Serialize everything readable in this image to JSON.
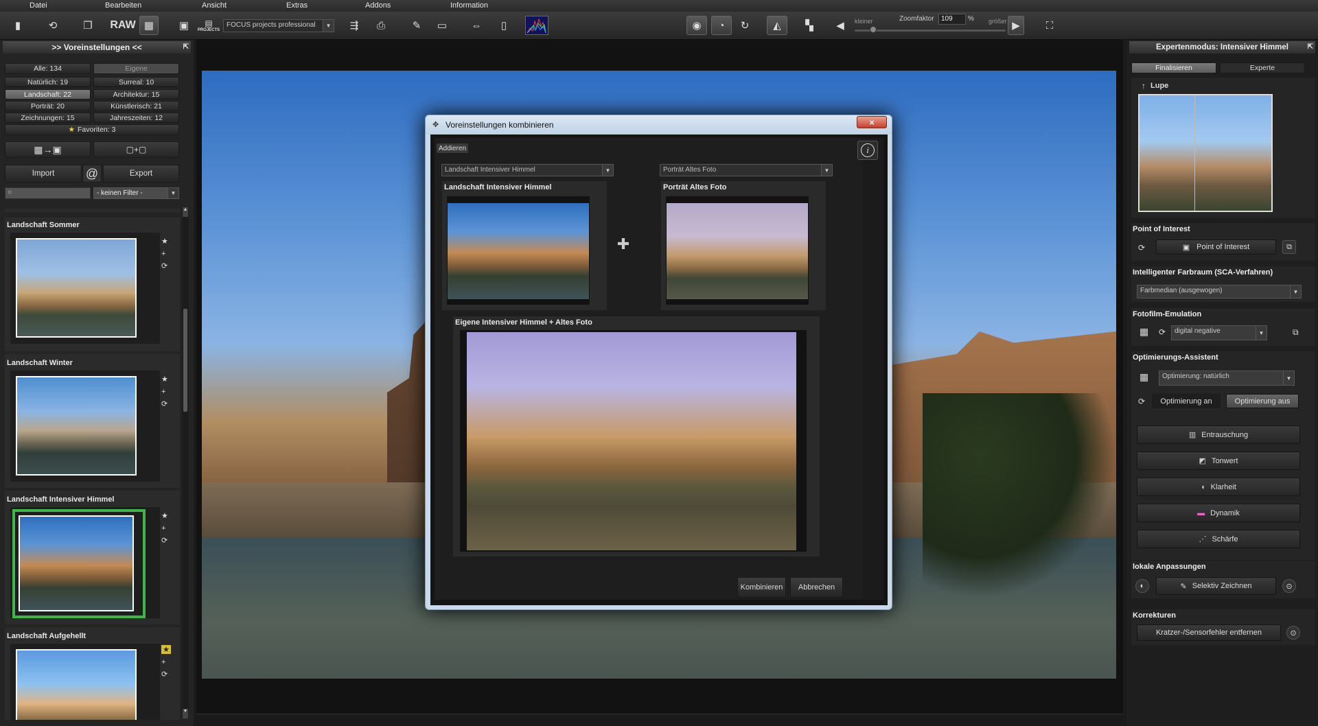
{
  "menu": [
    "Datei",
    "Bearbeiten",
    "Ansicht",
    "Extras",
    "Addons",
    "Information"
  ],
  "toolbar": {
    "raw_label": "RAW",
    "projects_label": "PROJECTS",
    "profile_select": "FOCUS projects professional",
    "zoom_smaller": "kleiner",
    "zoom_label": "Zoomfaktor",
    "zoom_value": "109",
    "zoom_unit": "%",
    "zoom_larger": "größer"
  },
  "left": {
    "title": ">> Voreinstellungen <<",
    "filters": [
      {
        "label": "Alle: 134"
      },
      {
        "label": "Eigene"
      },
      {
        "label": "Natürlich: 19"
      },
      {
        "label": "Surreal: 10"
      },
      {
        "label": "Landschaft: 22"
      },
      {
        "label": "Architektur: 15"
      },
      {
        "label": "Porträt: 20"
      },
      {
        "label": "Künstlerisch: 21"
      },
      {
        "label": "Zeichnungen: 15"
      },
      {
        "label": "Jahreszeiten: 12"
      }
    ],
    "favorites": "Favoriten: 3",
    "import_label": "Import",
    "export_label": "Export",
    "at_label": "@",
    "filter_select": "- keinen Filter -",
    "presets": [
      {
        "name": "Landschaft Sommer"
      },
      {
        "name": "Landschaft Winter"
      },
      {
        "name": "Landschaft Intensiver Himmel"
      },
      {
        "name": "Landschaft Aufgehellt"
      }
    ]
  },
  "dialog": {
    "title": "Voreinstellungen kombinieren",
    "close": "×",
    "add_tab": "Addieren",
    "select_left": "Landschaft Intensiver Himmel",
    "select_right": "Porträt Altes Foto",
    "label_left": "Landschaft Intensiver Himmel",
    "label_right": "Porträt Altes Foto",
    "plus": "✚",
    "result_label": "Eigene Intensiver Himmel + Altes Foto",
    "combine_button": "Kombinieren",
    "cancel_button": "Abbrechen",
    "info": "i"
  },
  "right": {
    "title": "Expertenmodus: Intensiver Himmel",
    "tab_finalize": "Finalisieren",
    "tab_expert": "Experte",
    "lupe": "Lupe",
    "poi_section": "Point of Interest",
    "poi_button": "Point of Interest",
    "sca_section": "Intelligenter Farbraum (SCA-Verfahren)",
    "sca_select": "Farbmedian (ausgewogen)",
    "film_section": "Fotofilm-Emulation",
    "film_select": "digital negative",
    "opt_section": "Optimierungs-Assistent",
    "opt_select": "Optimierung: natürlich",
    "opt_on": "Optimierung an",
    "opt_off": "Optimierung aus",
    "tools": [
      {
        "label": "Entrauschung"
      },
      {
        "label": "Tonwert"
      },
      {
        "label": "Klarheit"
      },
      {
        "label": "Dynamik"
      },
      {
        "label": "Schärfe"
      }
    ],
    "local_section": "lokale Anpassungen",
    "selective_button": "Selektiv Zeichnen",
    "corrections_section": "Korrekturen",
    "scratch_button": "Kratzer-/Sensorfehler entfernen"
  }
}
